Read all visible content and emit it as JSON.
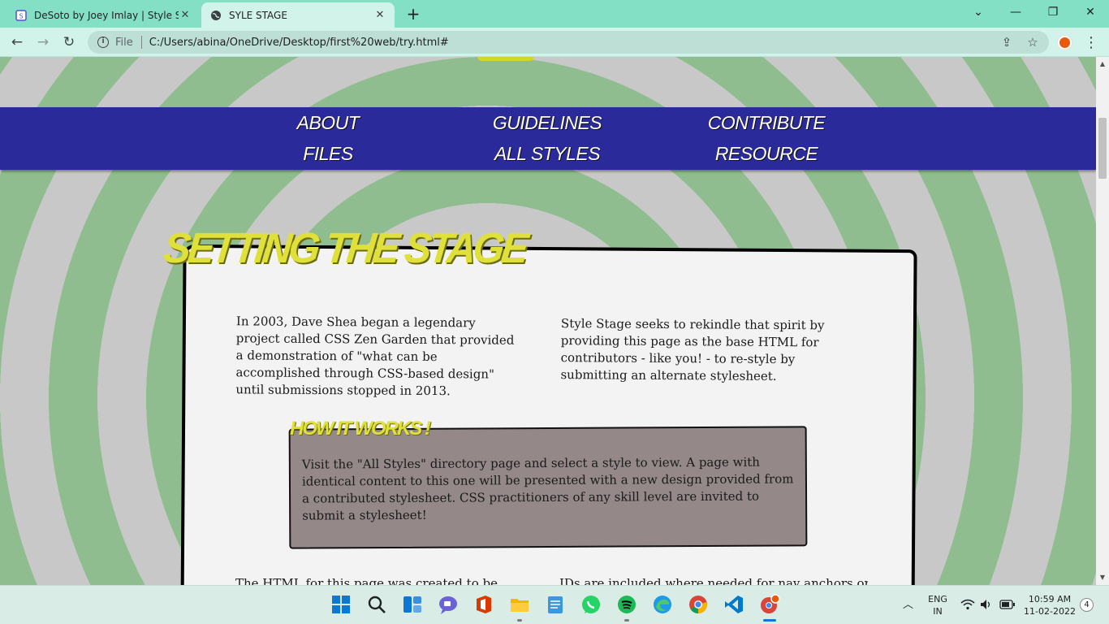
{
  "browser": {
    "tabs": [
      {
        "title": "DeSoto by Joey Imlay | Style Stag",
        "active": false
      },
      {
        "title": "SYLE STAGE",
        "active": true
      }
    ],
    "new_tab": "+",
    "window_controls": {
      "chevron": "⌄",
      "minimize": "—",
      "restore": "❐",
      "close": "✕"
    },
    "nav": {
      "back": "←",
      "forward": "→",
      "reload": "↻"
    },
    "address": {
      "scheme": "File",
      "url": "C:/Users/abina/OneDrive/Desktop/first%20web/try.html#"
    },
    "icons": {
      "share": "⇪",
      "bookmark": "☆",
      "menu": "⋮",
      "extension": "extension-icon",
      "info": "i"
    }
  },
  "page": {
    "nav_links": [
      "ABOUT",
      "GUIDELINES",
      "CONTRIBUTE",
      "FILES",
      "ALL STYLES",
      "RESOURCE"
    ],
    "stage_title": "Setting the Stage",
    "intro_left": "In 2003, Dave Shea began a legendary project called CSS Zen Garden that provided a demonstration of \"what can be accomplished through CSS-based design\" until submissions stopped in 2013.",
    "intro_right": "Style Stage seeks to rekindle that spirit by providing this page as the base HTML for contributors - like you! - to re-style by submitting an alternate stylesheet.",
    "how_title": "How it works !",
    "how_text": "Visit the \"All Styles\" directory page and select a style to view. A page with identical content to this one will be presented with a new design provided from a contributed stylesheet. CSS practitioners of any skill level are invited to submit a stylesheet!",
    "cut_left": "The HTML for this page was created to be",
    "cut_right": "IDs are included where needed for nav anchors or"
  },
  "taskbar": {
    "apps": [
      "windows-start",
      "search",
      "widgets",
      "teams-chat",
      "office",
      "file-explorer",
      "notepad",
      "whatsapp",
      "spotify",
      "edge",
      "chrome",
      "vscode",
      "chrome-canary"
    ],
    "language": {
      "line1": "ENG",
      "line2": "IN"
    },
    "time": "10:59 AM",
    "date": "11-02-2022",
    "notifications": "4"
  },
  "colors": {
    "tabbar": "#84e0c4",
    "nav_bg": "#2a2a9a",
    "title_yellow": "#e0e03a",
    "how_box": "#958888",
    "card": "#f3f3f3",
    "ring_green": "#8fbd8f",
    "ring_grey": "#c8c8c8"
  }
}
